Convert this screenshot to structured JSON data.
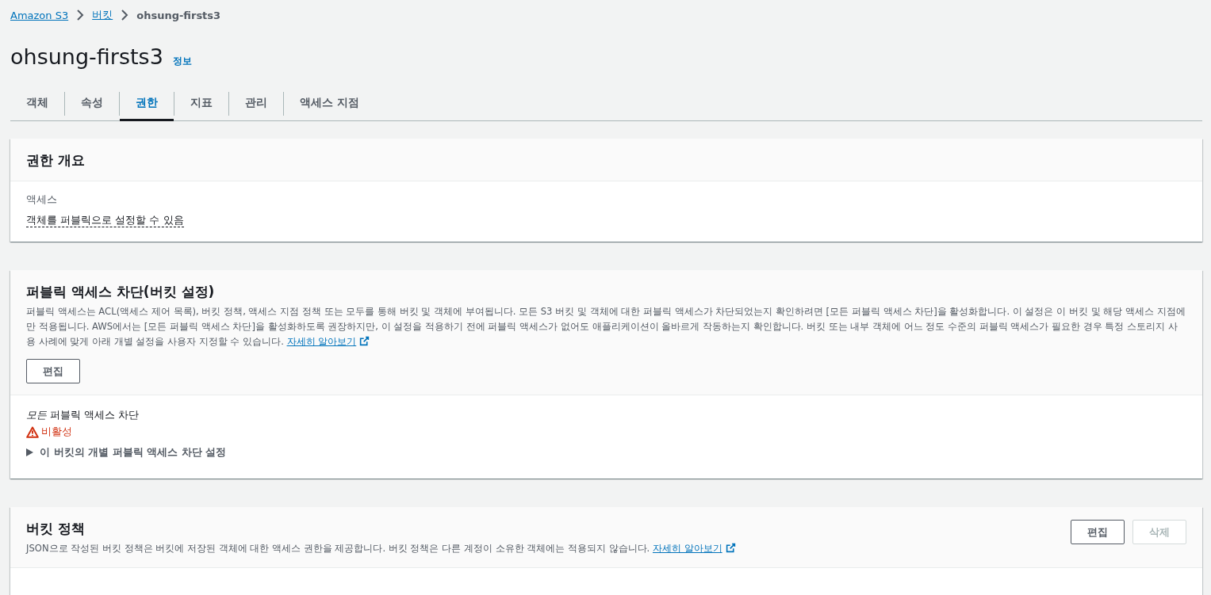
{
  "breadcrumbs": [
    {
      "label": "Amazon S3",
      "link": true
    },
    {
      "label": "버킷",
      "link": true
    },
    {
      "label": "ohsung-firsts3",
      "link": false
    }
  ],
  "page": {
    "title": "ohsung-firsts3",
    "info": "정보"
  },
  "tabs": [
    {
      "label": "객체",
      "selected": false
    },
    {
      "label": "속성",
      "selected": false
    },
    {
      "label": "권한",
      "selected": true
    },
    {
      "label": "지표",
      "selected": false
    },
    {
      "label": "관리",
      "selected": false
    },
    {
      "label": "액세스 지점",
      "selected": false
    }
  ],
  "overview": {
    "title": "권한 개요",
    "label": "액세스",
    "value": "객체를 퍼블릭으로 설정할 수 있음"
  },
  "block_public_access": {
    "title": "퍼블릭 액세스 차단(버킷 설정)",
    "description": "퍼블릭 액세스는 ACL(액세스 제어 목록), 버킷 정책, 액세스 지점 정책 또는 모두를 통해 버킷 및 객체에 부여됩니다. 모든 S3 버킷 및 객체에 대한 퍼블릭 액세스가 차단되었는지 확인하려면 [모든 퍼블릭 액세스 차단]을 활성화합니다. 이 설정은 이 버킷 및 해당 액세스 지점에만 적용됩니다. AWS에서는 [모든 퍼블릭 액세스 차단]을 활성화하도록 권장하지만, 이 설정을 적용하기 전에 퍼블릭 액세스가 없어도 애플리케이션이 올바르게 작동하는지 확인합니다. 버킷 또는 내부 객체에 어느 정도 수준의 퍼블릭 액세스가 필요한 경우 특정 스토리지 사용 사례에 맞게 아래 개별 설정을 사용자 지정할 수 있습니다.",
    "link": "자세히 알아보기",
    "edit_button": "편집",
    "setting_label": "*모든* 퍼블릭 액세스 차단",
    "status": "비활성",
    "status_warning": true,
    "expander": "이 버킷의 개별 퍼블릭 액세스 차단 설정",
    "expanded": false
  },
  "bucket_policy": {
    "title": "버킷 정책",
    "description": "JSON으로 작성된 버킷 정책은 버킷에 저장된 객체에 대한 액세스 권한을 제공합니다. 버킷 정책은 다른 계정이 소유한 객체에는 적용되지 않습니다.",
    "link": "자세히 알아보기",
    "buttons": [
      {
        "label": "편집",
        "disabled": false
      },
      {
        "label": "삭제",
        "disabled": true
      }
    ]
  }
}
